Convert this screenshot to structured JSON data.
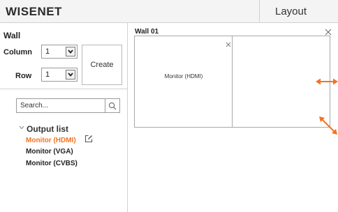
{
  "app": {
    "logo": "WISENET",
    "page_title": "Layout"
  },
  "left_panel": {
    "wall_label": "Wall",
    "column": {
      "label": "Column",
      "value": "1"
    },
    "row": {
      "label": "Row",
      "value": "1"
    },
    "create_label": "Create",
    "search": {
      "placeholder": "Search..."
    },
    "output_list": {
      "title": "Output list",
      "items": [
        {
          "label": "Monitor (HDMI)",
          "selected": true
        },
        {
          "label": "Monitor (VGA)",
          "selected": false
        },
        {
          "label": "Monitor (CVBS)",
          "selected": false
        }
      ]
    }
  },
  "wall": {
    "title": "Wall 01",
    "cells": [
      {
        "label": "Monitor (HDMI)"
      },
      {
        "label": ""
      }
    ]
  },
  "colors": {
    "accent": "#f37321",
    "border": "#a8a8a8",
    "topbar_bg": "#f4f4f4"
  },
  "icons": {
    "close": "close-icon",
    "search": "search-icon",
    "edit": "edit-icon",
    "dropdown": "chevron-down-icon",
    "collapse": "chevron-down-icon",
    "resize_horizontal": "resize-horizontal-arrow-icon",
    "resize_diagonal": "resize-diagonal-arrow-icon"
  }
}
